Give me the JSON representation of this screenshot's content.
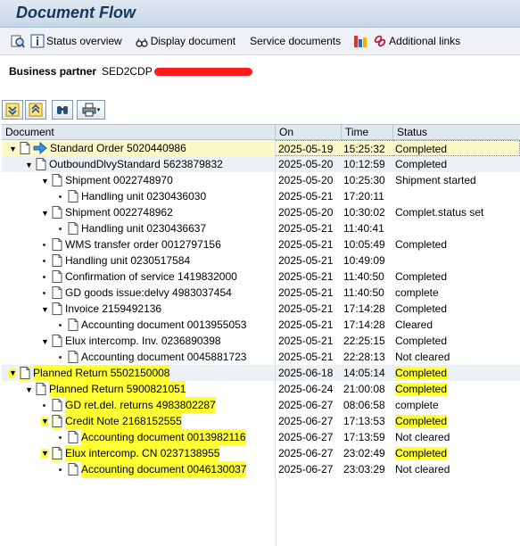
{
  "title": "Document Flow",
  "toolbar": {
    "status_overview": "Status overview",
    "display_document": "Display document",
    "service_documents": "Service documents",
    "additional_links": "Additional links"
  },
  "business_partner": {
    "label": "Business partner",
    "value": "SED2CDP"
  },
  "table": {
    "headers": {
      "document": "Document",
      "on": "On",
      "time": "Time",
      "status": "Status"
    },
    "rows": [
      {
        "document": "Standard Order 5020440986",
        "on": "2025-05-19",
        "time": "15:25:32",
        "status": "Completed"
      },
      {
        "document": "OutboundDlvyStandard 5623879832",
        "on": "2025-05-20",
        "time": "10:12:59",
        "status": "Completed"
      },
      {
        "document": "Shipment 0022748970",
        "on": "2025-05-20",
        "time": "10:25:30",
        "status": "Shipment started"
      },
      {
        "document": "Handling unit 0230436030",
        "on": "2025-05-21",
        "time": "17:20:11",
        "status": ""
      },
      {
        "document": "Shipment 0022748962",
        "on": "2025-05-20",
        "time": "10:30:02",
        "status": "Complet.status set"
      },
      {
        "document": "Handling unit 0230436637",
        "on": "2025-05-21",
        "time": "11:40:41",
        "status": ""
      },
      {
        "document": "WMS transfer order 0012797156",
        "on": "2025-05-21",
        "time": "10:05:49",
        "status": "Completed"
      },
      {
        "document": "Handling unit 0230517584",
        "on": "2025-05-21",
        "time": "10:49:09",
        "status": ""
      },
      {
        "document": "Confirmation of service 1419832000",
        "on": "2025-05-21",
        "time": "11:40:50",
        "status": "Completed"
      },
      {
        "document": "GD goods issue:delvy 4983037454",
        "on": "2025-05-21",
        "time": "11:40:50",
        "status": "complete"
      },
      {
        "document": "Invoice 2159492136",
        "on": "2025-05-21",
        "time": "17:14:28",
        "status": "Completed"
      },
      {
        "document": "Accounting document 0013955053",
        "on": "2025-05-21",
        "time": "17:14:28",
        "status": "Cleared"
      },
      {
        "document": "Elux intercomp. Inv. 0236890398",
        "on": "2025-05-21",
        "time": "22:25:15",
        "status": "Completed"
      },
      {
        "document": "Accounting document 0045881723",
        "on": "2025-05-21",
        "time": "22:28:13",
        "status": "Not cleared"
      },
      {
        "document": "Planned Return 5502150008",
        "on": "2025-06-18",
        "time": "14:05:14",
        "status": "Completed"
      },
      {
        "document": "Planned Return 5900821051",
        "on": "2025-06-24",
        "time": "21:00:08",
        "status": "Completed"
      },
      {
        "document": "GD ret.del.  returns 4983802287",
        "on": "2025-06-27",
        "time": "08:06:58",
        "status": "complete"
      },
      {
        "document": "Credit Note 2168152555",
        "on": "2025-06-27",
        "time": "17:13:53",
        "status": "Completed"
      },
      {
        "document": "Accounting document 0013982116",
        "on": "2025-06-27",
        "time": "17:13:59",
        "status": "Not cleared"
      },
      {
        "document": "Elux intercomp. CN 0237138955",
        "on": "2025-06-27",
        "time": "23:02:49",
        "status": "Completed"
      },
      {
        "document": "Accounting document 0046130037",
        "on": "2025-06-27",
        "time": "23:03:29",
        "status": "Not cleared"
      }
    ]
  },
  "colors": {
    "highlight": "#ffff33",
    "selected_row": "#fdf8c8",
    "band": "#ecf1f6",
    "redaction": "#ff1a1a"
  }
}
